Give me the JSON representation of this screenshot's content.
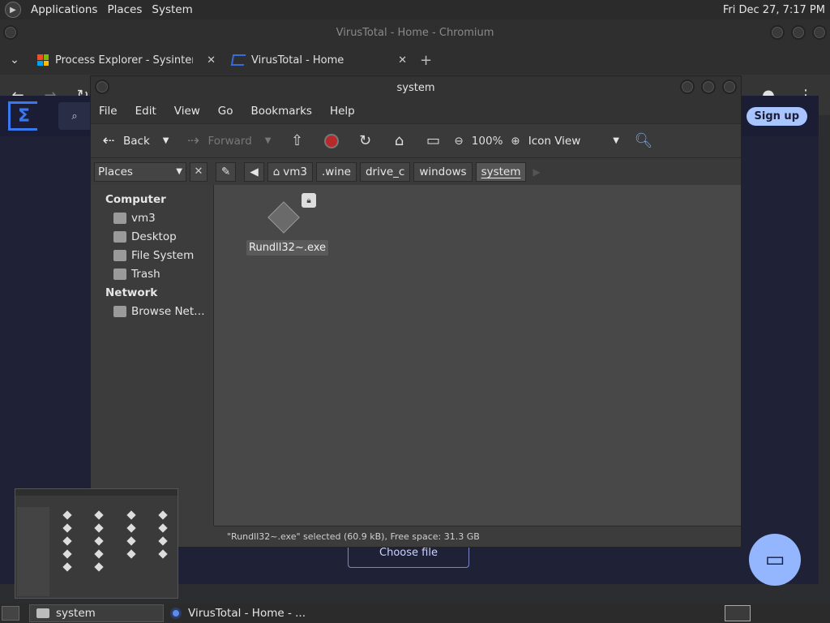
{
  "top_panel": {
    "menus": [
      "Applications",
      "Places",
      "System"
    ],
    "clock": "Fri Dec 27,  7:17 PM"
  },
  "chromium": {
    "title": "VirusTotal - Home - Chromium",
    "tabs": [
      {
        "label": "Process Explorer - Sysinterna",
        "close": "✕"
      },
      {
        "label": "VirusTotal - Home",
        "close": "✕"
      }
    ],
    "new_tab": "+"
  },
  "virustotal": {
    "signup": "Sign up",
    "choose_file": "Choose file"
  },
  "file_manager": {
    "title": "system",
    "menu": [
      "File",
      "Edit",
      "View",
      "Go",
      "Bookmarks",
      "Help"
    ],
    "toolbar": {
      "back": "Back",
      "forward": "Forward",
      "zoom": "100%",
      "view": "Icon View"
    },
    "places_label": "Places",
    "breadcrumbs": [
      "vm3",
      ".wine",
      "drive_c",
      "windows",
      "system"
    ],
    "sidebar": {
      "computer_header": "Computer",
      "computer_items": [
        "vm3",
        "Desktop",
        "File System",
        "Trash"
      ],
      "network_header": "Network",
      "network_items": [
        "Browse Net…"
      ]
    },
    "file": {
      "name": "Rundll32~.exe"
    },
    "status": "\"Rundll32~.exe\" selected (60.9 kB), Free space: 31.3 GB"
  },
  "taskbar": {
    "items": [
      {
        "label": "system"
      },
      {
        "label": "VirusTotal - Home - ..."
      }
    ]
  }
}
